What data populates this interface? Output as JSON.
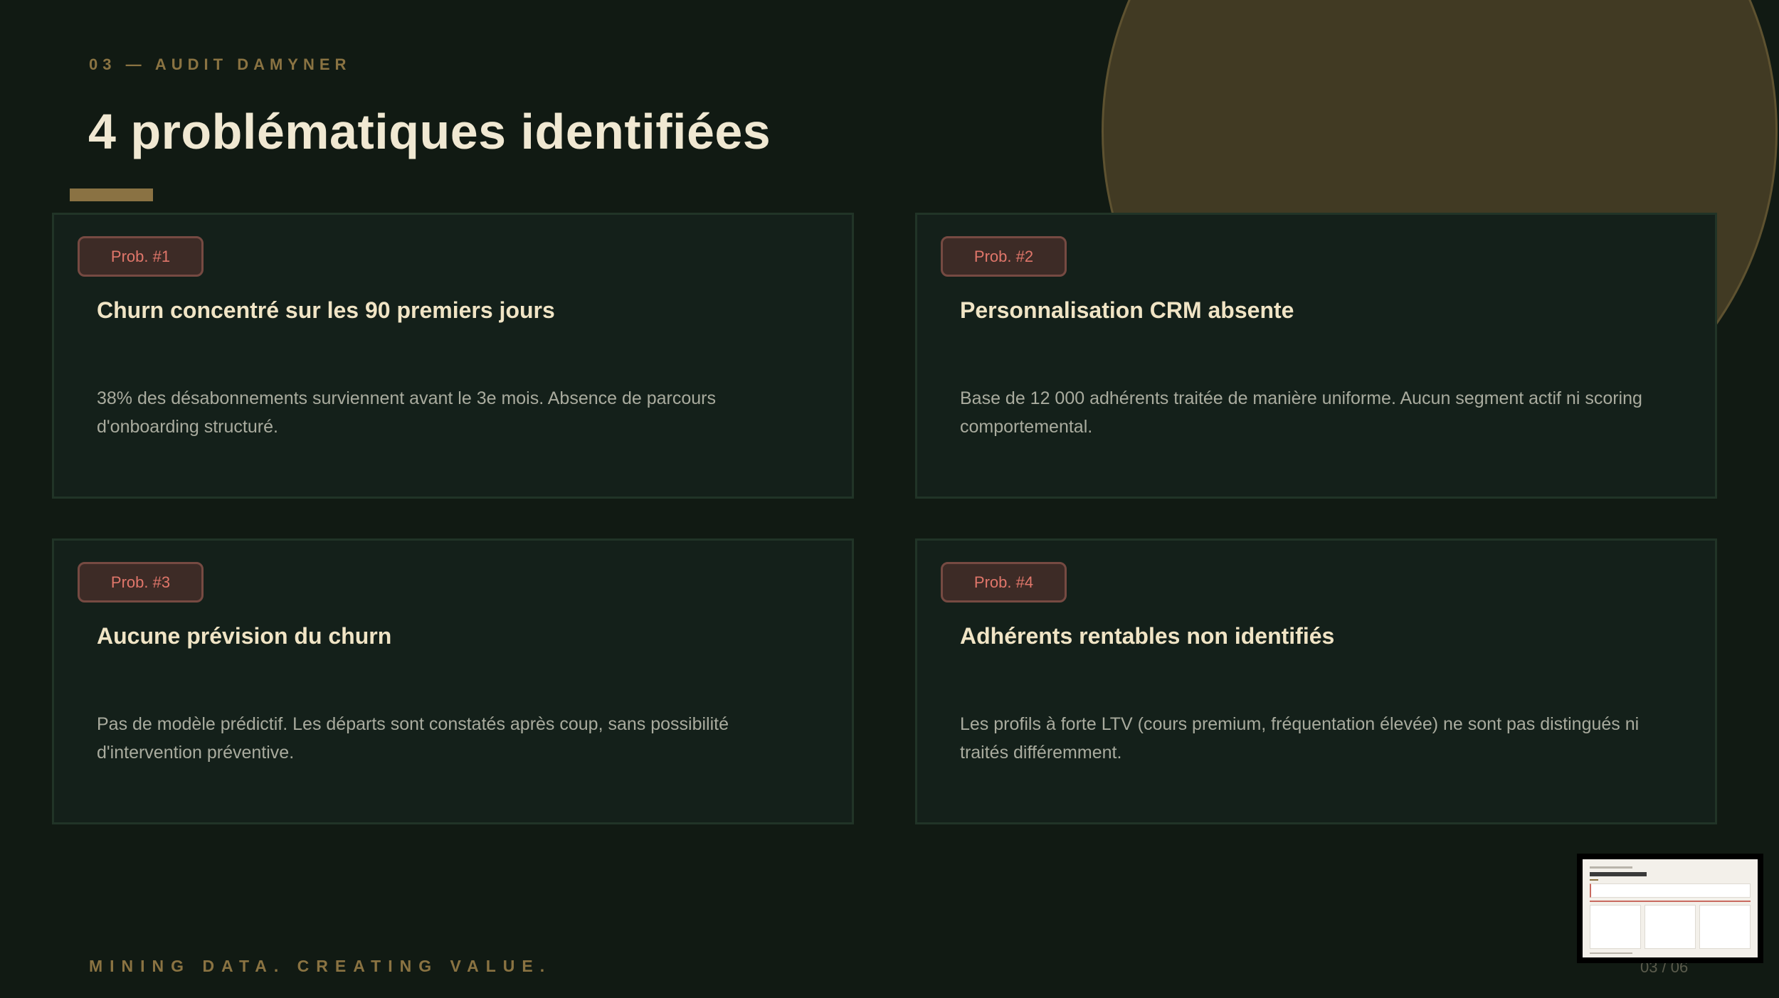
{
  "header": {
    "eyebrow": "03 — AUDIT DAMYNER",
    "title": "4 problématiques identifiées"
  },
  "cards": [
    {
      "badge": "Prob. #1",
      "title": "Churn concentré sur les 90 premiers jours",
      "description": "38% des désabonnements surviennent avant le 3e mois. Absence de parcours d'onboarding structuré."
    },
    {
      "badge": "Prob. #2",
      "title": "Personnalisation CRM absente",
      "description": "Base de 12 000 adhérents traitée de manière uniforme. Aucun segment actif ni scoring comportemental."
    },
    {
      "badge": "Prob. #3",
      "title": "Aucune prévision du churn",
      "description": "Pas de modèle prédictif. Les départs sont constatés après coup, sans possibilité d'intervention préventive."
    },
    {
      "badge": "Prob. #4",
      "title": "Adhérents rentables non identifiés",
      "description": "Les profils à forte LTV (cours premium, fréquentation élevée) ne sont pas distingués ni traités différemment."
    }
  ],
  "footer": {
    "tagline": "MINING DATA. CREATING VALUE.",
    "page_number": "03 / 06"
  },
  "colors": {
    "background": "#111a13",
    "accent_gold": "#8a7342",
    "badge_text": "#e0766a",
    "title_text": "#f0e8d2"
  }
}
